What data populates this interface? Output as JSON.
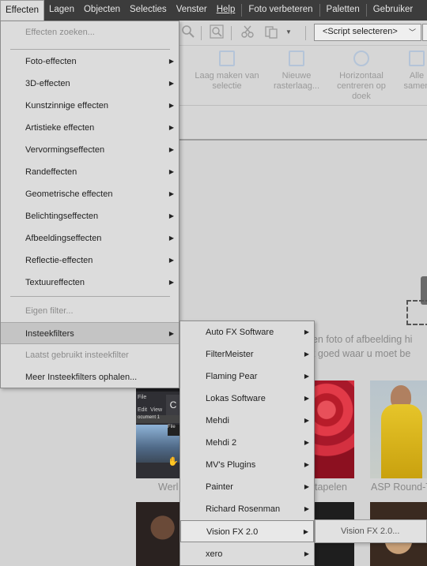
{
  "menubar": {
    "items": [
      "Effecten",
      "Lagen",
      "Objecten",
      "Selecties",
      "Venster",
      "Help",
      "Foto verbeteren",
      "Paletten",
      "Gebruiker"
    ]
  },
  "toolbar": {
    "script_select": "<Script selecteren>"
  },
  "ribbon": {
    "buttons": [
      "Laag maken van selectie",
      "Nieuwe rasterlaag...",
      "Horizontaal centreren op doek",
      "Alle samen"
    ]
  },
  "workspace": {
    "drop_line1": "een foto of afbeelding hi",
    "drop_line2": "et goed waar u moet be",
    "thumbs": [
      "Werl",
      "tapelen",
      "ASP Round-T"
    ],
    "thumb_ui": {
      "file": "File",
      "edit": "Edit",
      "view": "View",
      "document": "ocument 1",
      "c": "C"
    }
  },
  "effects_menu": {
    "items": [
      {
        "label": "Effecten zoeken...",
        "disabled": true,
        "submenu": false
      },
      {
        "label": "Foto-effecten",
        "submenu": true
      },
      {
        "label": "3D-effecten",
        "submenu": true
      },
      {
        "label": "Kunstzinnige effecten",
        "submenu": true
      },
      {
        "label": "Artistieke effecten",
        "submenu": true
      },
      {
        "label": "Vervormingseffecten",
        "submenu": true
      },
      {
        "label": "Randeffecten",
        "submenu": true
      },
      {
        "label": "Geometrische effecten",
        "submenu": true
      },
      {
        "label": "Belichtingseffecten",
        "submenu": true
      },
      {
        "label": "Afbeeldingseffecten",
        "submenu": true
      },
      {
        "label": "Reflectie-effecten",
        "submenu": true
      },
      {
        "label": "Textuureffecten",
        "submenu": true
      },
      {
        "label": "Eigen filter...",
        "disabled": true,
        "submenu": false
      },
      {
        "label": "Insteekfilters",
        "submenu": true,
        "highlighted": true
      },
      {
        "label": "Laatst gebruikt insteekfilter",
        "disabled": true,
        "submenu": false
      },
      {
        "label": "Meer Insteekfilters ophalen...",
        "submenu": false
      }
    ]
  },
  "plugins_menu": {
    "items": [
      {
        "label": "Auto FX Software"
      },
      {
        "label": "FilterMeister"
      },
      {
        "label": "Flaming Pear"
      },
      {
        "label": "Lokas Software"
      },
      {
        "label": "Mehdi"
      },
      {
        "label": "Mehdi 2"
      },
      {
        "label": "MV's Plugins"
      },
      {
        "label": "Painter"
      },
      {
        "label": "Richard Rosenman"
      },
      {
        "label": "Vision FX 2.0",
        "highlighted": true
      },
      {
        "label": "xero"
      }
    ]
  },
  "visionfx_menu": {
    "items": [
      {
        "label": "Vision FX 2.0...",
        "disabled": true
      }
    ]
  },
  "colors": {
    "menubar_bg": "#3c3c3c",
    "menu_bg": "#dcdcdc",
    "workspace_bg": "#d3d3d3"
  }
}
